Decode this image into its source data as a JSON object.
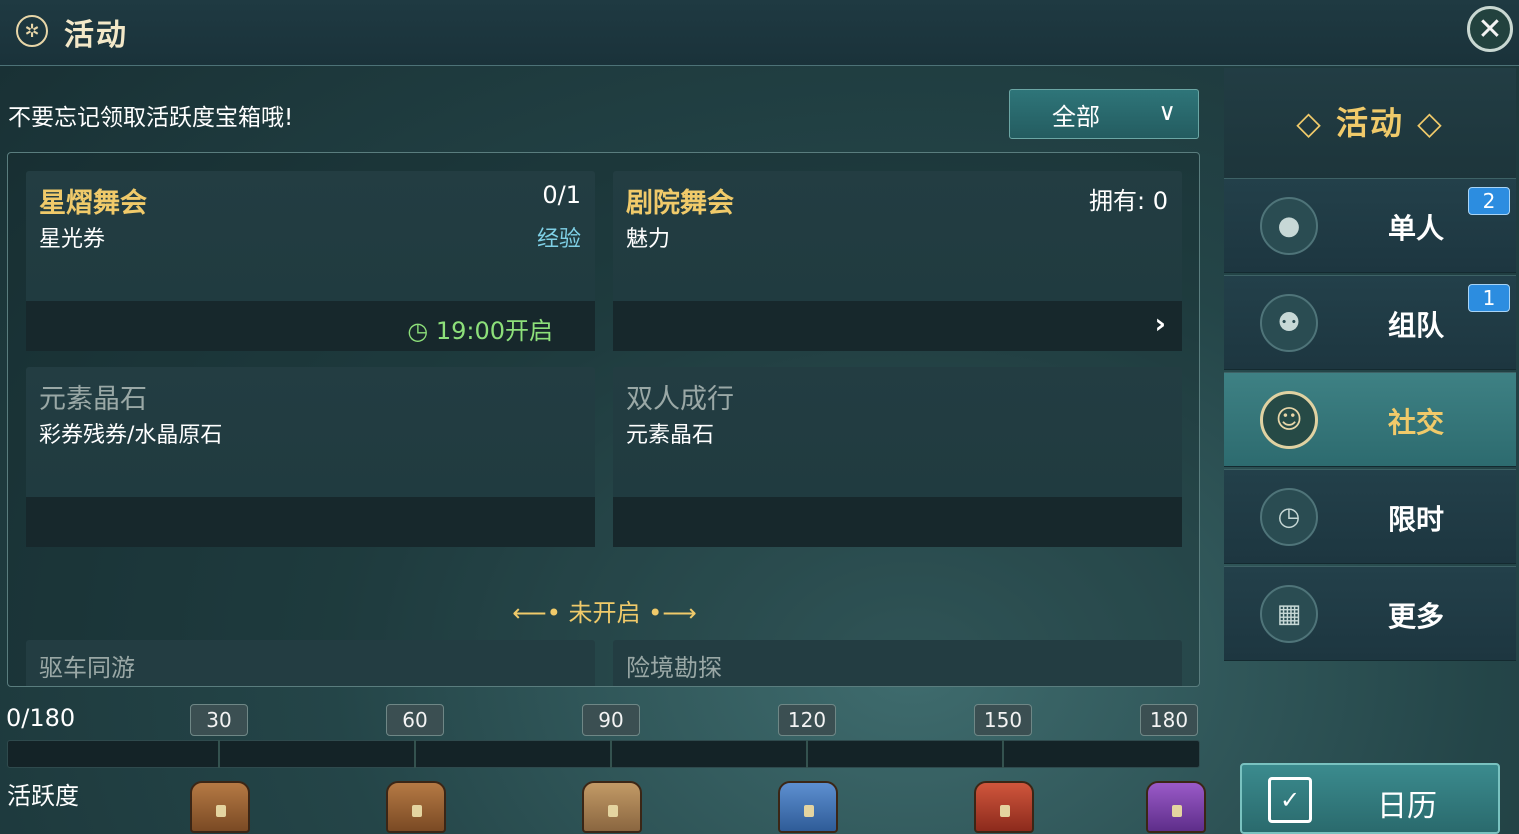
{
  "header": {
    "title": "活动",
    "logo_icon": "wheel-icon",
    "close_icon": "close-icon"
  },
  "reminder": "不要忘记领取活跃度宝箱哦!",
  "filter": {
    "label": "全部",
    "chevron": "chevron-down-icon"
  },
  "cards": [
    {
      "name": "星熠舞会",
      "sub": "星光券",
      "count": "0/1",
      "tag": "经验",
      "time": "19:00开启"
    },
    {
      "name": "剧院舞会",
      "sub": "魅力",
      "count": "拥有: 0",
      "arrow": "›"
    },
    {
      "name": "元素晶石",
      "sub": "彩券残券/水晶原石"
    },
    {
      "name": "双人成行",
      "sub": "元素晶石"
    }
  ],
  "not_open_label": "未开启",
  "partial_cards": [
    "驱车同游",
    "险境勘探"
  ],
  "activity": {
    "progress": "0/180",
    "current": 0,
    "max": 180,
    "milestones": [
      "30",
      "60",
      "90",
      "120",
      "150",
      "180"
    ],
    "label": "活跃度"
  },
  "sidebar": {
    "title": "活动",
    "items": [
      {
        "label": "单人",
        "badge": "2",
        "icon": "person-icon"
      },
      {
        "label": "组队",
        "badge": "1",
        "icon": "team-icon"
      },
      {
        "label": "社交",
        "icon": "social-icon",
        "active": true
      },
      {
        "label": "限时",
        "icon": "clock-icon"
      },
      {
        "label": "更多",
        "icon": "grid-icon"
      }
    ],
    "calendar_label": "日历"
  },
  "colors": {
    "gold": "#f0ca6a",
    "green": "#8de07a",
    "teal_active": "#3e8184"
  }
}
